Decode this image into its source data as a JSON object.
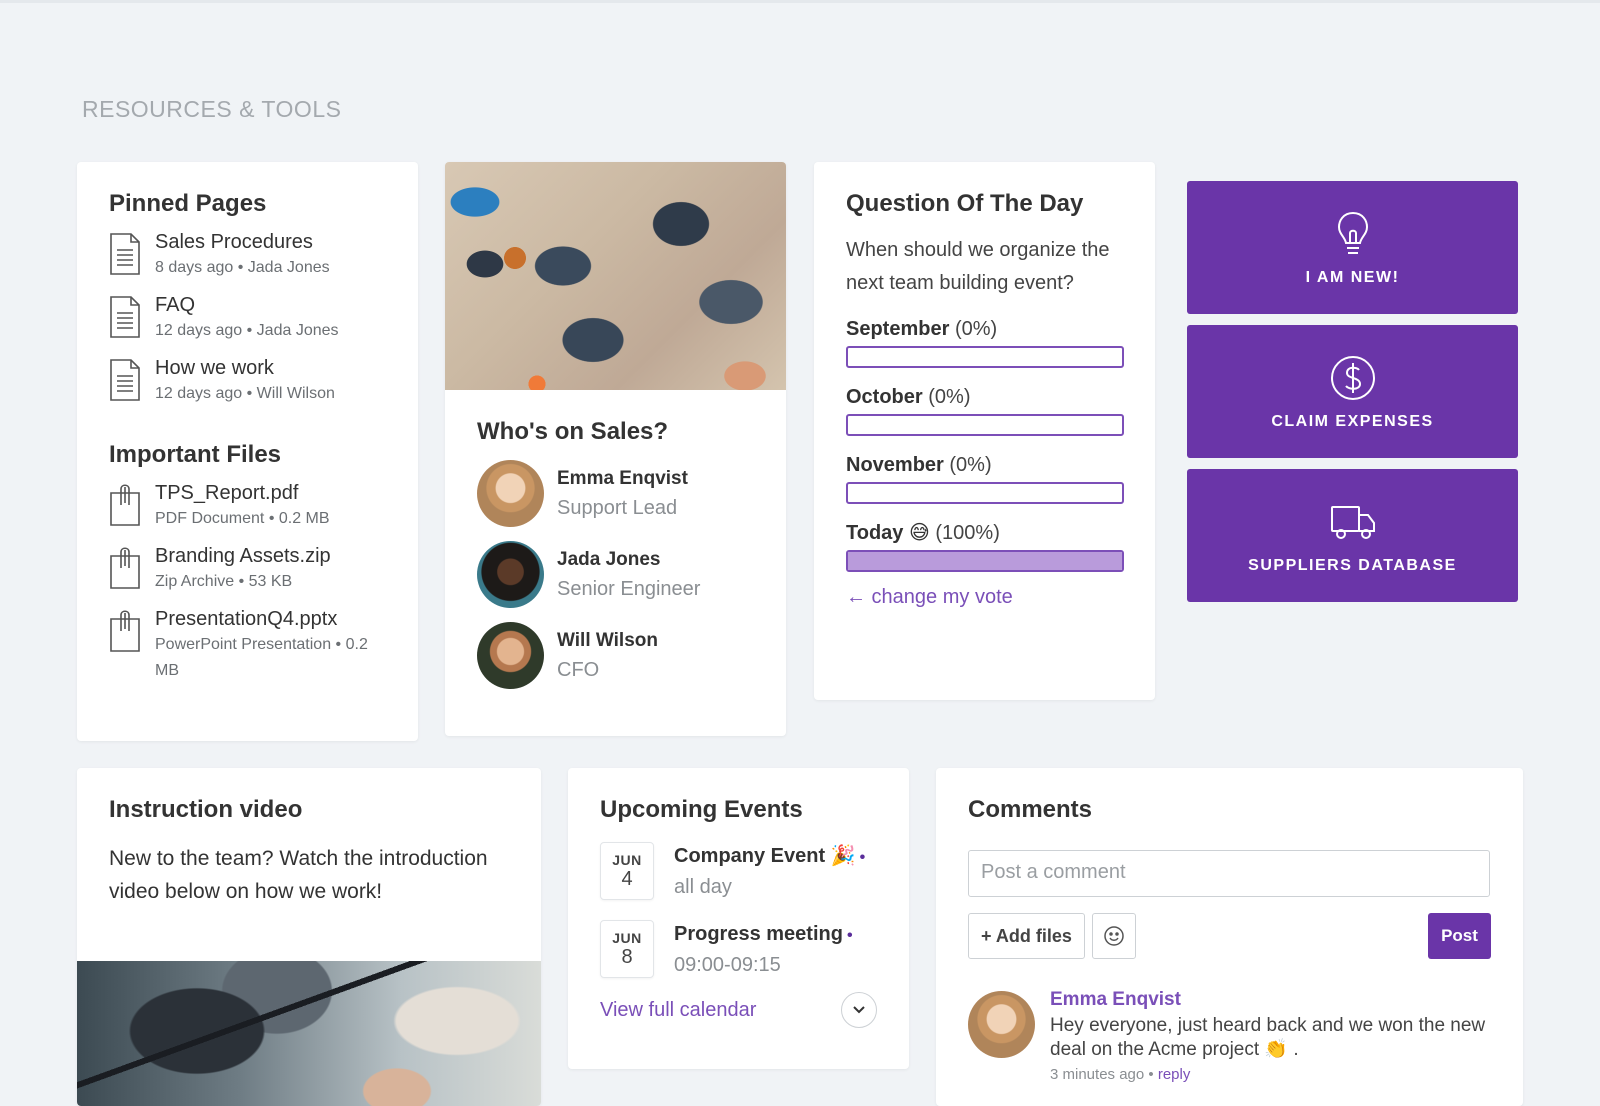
{
  "section_title": "RESOURCES & TOOLS",
  "pinned_pages": {
    "heading": "Pinned Pages",
    "items": [
      {
        "title": "Sales Procedures",
        "meta": "8 days ago • Jada Jones",
        "icon": "document-icon"
      },
      {
        "title": "FAQ",
        "meta": "12 days ago • Jada Jones",
        "icon": "document-icon"
      },
      {
        "title": "How we work",
        "meta": "12 days ago • Will Wilson",
        "icon": "document-icon"
      }
    ]
  },
  "important_files": {
    "heading": "Important Files",
    "items": [
      {
        "title": "TPS_Report.pdf",
        "meta": "PDF Document • 0.2 MB",
        "icon": "attachment-icon"
      },
      {
        "title": "Branding Assets.zip",
        "meta": "Zip Archive • 53 KB",
        "icon": "attachment-icon"
      },
      {
        "title": "PresentationQ4.pptx",
        "meta": "PowerPoint Presentation • 0.2 MB",
        "icon": "attachment-icon"
      }
    ]
  },
  "sales": {
    "heading": "Who's on Sales?",
    "people": [
      {
        "name": "Emma Enqvist",
        "role": "Support Lead"
      },
      {
        "name": "Jada Jones",
        "role": "Senior Engineer"
      },
      {
        "name": "Will Wilson",
        "role": "CFO"
      }
    ]
  },
  "qotd": {
    "heading": "Question Of The Day",
    "question": "When should we organize the next team building event?",
    "options": [
      {
        "label": "September",
        "pct_text": "(0%)",
        "fraction": 0
      },
      {
        "label": "October",
        "pct_text": "(0%)",
        "fraction": 0
      },
      {
        "label": "November",
        "pct_text": "(0%)",
        "fraction": 0
      },
      {
        "label": "Today 😅",
        "pct_text": "(100%)",
        "fraction": 1
      }
    ],
    "change_vote": "← change my vote"
  },
  "tiles": [
    {
      "label": "I AM NEW!",
      "icon": "lightbulb-icon"
    },
    {
      "label": "CLAIM EXPENSES",
      "icon": "dollar-icon"
    },
    {
      "label": "SUPPLIERS DATABASE",
      "icon": "truck-icon"
    }
  ],
  "video": {
    "heading": "Instruction video",
    "text": "New to the team? Watch the introduction video below on how we work!"
  },
  "events": {
    "heading": "Upcoming Events",
    "items": [
      {
        "month": "JUN",
        "day": "4",
        "title": "Company Event 🎉",
        "time": "all day"
      },
      {
        "month": "JUN",
        "day": "8",
        "title": "Progress meeting",
        "time": "09:00-09:15"
      }
    ],
    "dot": "•",
    "view_calendar": "View full calendar"
  },
  "comments": {
    "heading": "Comments",
    "placeholder": "Post a comment",
    "add_files": "+ Add files",
    "post": "Post",
    "items": [
      {
        "author": "Emma Enqvist",
        "text": "Hey everyone, just heard back and we won the new deal on the Acme project 👏 .",
        "time": "3 minutes ago",
        "sep": "•",
        "reply": "reply"
      }
    ]
  },
  "colors": {
    "accent": "#6a35a8",
    "link": "#7a4fb8",
    "background": "#f0f3f6"
  }
}
